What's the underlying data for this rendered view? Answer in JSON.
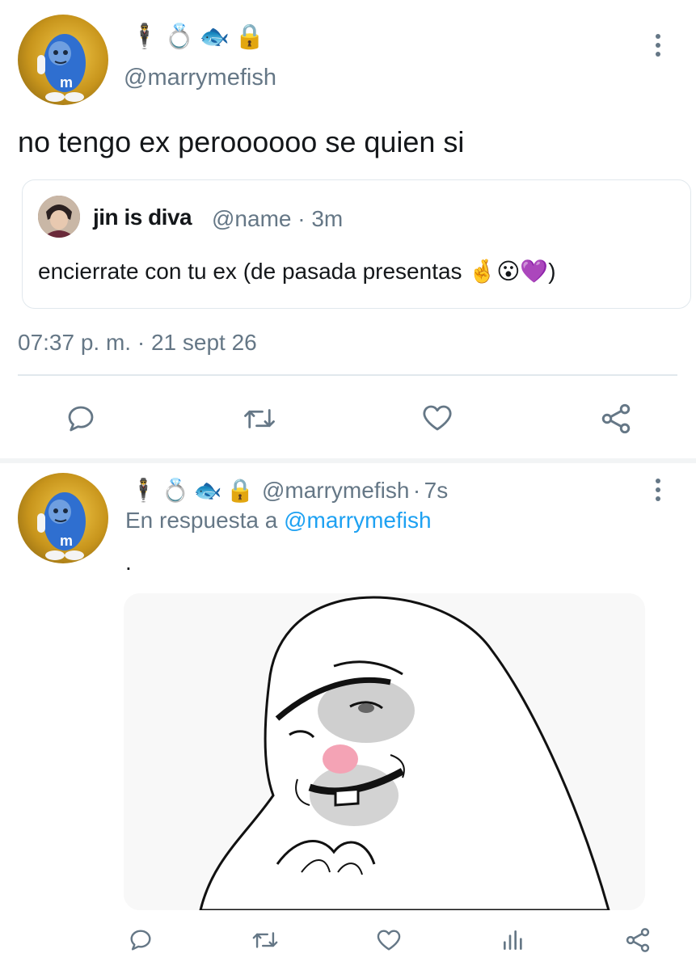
{
  "tweet": {
    "author_emojis": [
      "🕴",
      "💍",
      "🐟",
      "🔒"
    ],
    "author_handle": "@marrymefish",
    "text": "no tengo ex peroooooo se quien si",
    "quote": {
      "author_name": "jin is diva",
      "author_handle": "@name",
      "separator": "·",
      "time": "3m",
      "text": "encierrate con tu ex (de pasada presentas 🤞😮💜)"
    },
    "timestamp": "07:37 p. m. · 21 sept 26",
    "actions": [
      "reply-icon",
      "retweet-icon",
      "like-icon",
      "share-icon"
    ]
  },
  "reply": {
    "author_emojis": [
      "🕴",
      "💍",
      "🐟",
      "🔒"
    ],
    "author_handle": "@marrymefish",
    "separator": "·",
    "time": "7s",
    "replying_prefix": "En respuesta a",
    "replying_to": "@marrymefish",
    "text": ".",
    "media": "troll-face-meme-image",
    "actions": [
      "reply-icon",
      "retweet-icon",
      "like-icon",
      "analytics-icon",
      "share-icon"
    ]
  },
  "colors": {
    "text": "#14171a",
    "muted": "#657786",
    "link": "#1da1f2",
    "divider": "#e1e8ed"
  }
}
